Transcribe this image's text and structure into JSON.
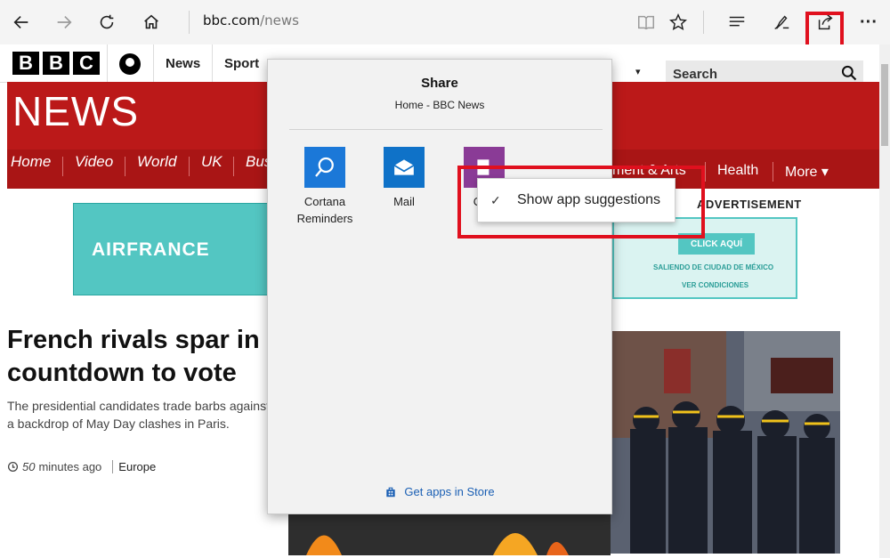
{
  "browser": {
    "address_domain": "bbc.com",
    "address_path": "/news",
    "icons": [
      "back-icon",
      "forward-icon",
      "refresh-icon",
      "home-icon",
      "reading-view-icon",
      "favorite-star-icon",
      "hub-icon",
      "web-note-icon",
      "share-icon",
      "more-icon"
    ],
    "more_glyph": "···"
  },
  "bbc": {
    "logo_letters": [
      "B",
      "B",
      "C"
    ],
    "top_nav": [
      "News",
      "Sport"
    ],
    "dropdown_glyph": "▾",
    "search_placeholder": "Search",
    "news_title": "NEWS",
    "nav_left": [
      "Home",
      "Video",
      "World",
      "UK",
      "Bus"
    ],
    "nav_right_partial": "ment & Arts",
    "nav_health": "Health",
    "nav_more": "More ▾",
    "advertisement_label": "ADVERTISEMENT",
    "ad_brand": "AIRFRANCE",
    "ad_cta": "CLICK AQUÍ",
    "ad_line1": "SALIENDO DE CIUDAD DE MÉXICO",
    "ad_line2": "VER CONDICIONES",
    "headline": "French rivals spar in countdown to vote",
    "summary": "The presidential candidates trade barbs against a backdrop of May Day clashes in Paris.",
    "time_num": "50",
    "time_rest": "minutes ago",
    "category": "Europe"
  },
  "share": {
    "title": "Share",
    "subtitle": "Home - BBC News",
    "apps": [
      {
        "label_line1": "Cortana",
        "label_line2": "Reminders",
        "icon": "cortana-icon",
        "color": "#1b78d8"
      },
      {
        "label_line1": "Mail",
        "label_line2": "",
        "icon": "mail-icon",
        "color": "#0f72c8"
      },
      {
        "label_line1": "One",
        "label_line2": "",
        "icon": "onenote-icon",
        "color": "#8a3b96"
      }
    ],
    "store_link": "Get apps in Store"
  },
  "context_menu": {
    "check": "✓",
    "label": "Show app suggestions"
  },
  "colors": {
    "bbc_red": "#bb1919",
    "highlight": "#e0101e",
    "link_blue": "#1a5fb4",
    "ad_teal": "#53c6c2"
  }
}
